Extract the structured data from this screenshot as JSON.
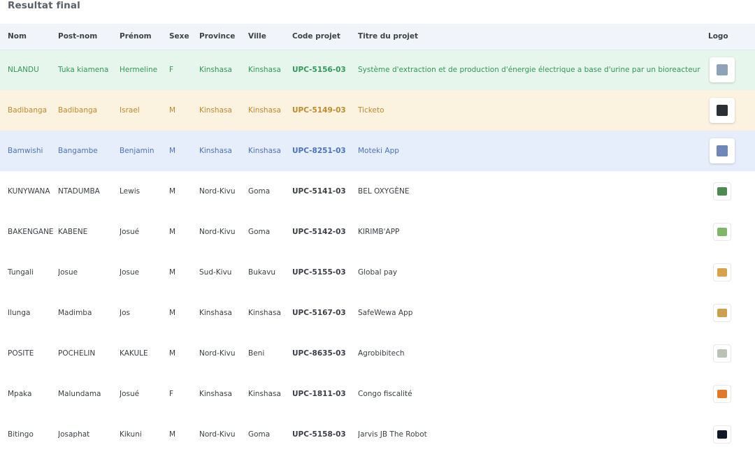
{
  "section_title": "Resultat final",
  "headers": {
    "nom": "Nom",
    "postnom": "Post-nom",
    "prenom": "Prénom",
    "sexe": "Sexe",
    "province": "Province",
    "ville": "Ville",
    "code": "Code projet",
    "titre": "Titre du projet",
    "logo": "Logo"
  },
  "rows": [
    {
      "nom": "NLANDU",
      "postnom": "Tuka kiamena",
      "prenom": "Hermeline",
      "sexe": "F",
      "province": "Kinshasa",
      "ville": "Kinshasa",
      "code": "UPC-5156-03",
      "titre": "Système d'extraction et de production d'énergie électrique a base d'urine par un bioreacteur"
    },
    {
      "nom": "Badibanga",
      "postnom": "Badibanga",
      "prenom": "Israel",
      "sexe": "M",
      "province": "Kinshasa",
      "ville": "Kinshasa",
      "code": "UPC-5149-03",
      "titre": "Ticketo"
    },
    {
      "nom": "Bamwishi",
      "postnom": "Bangambe",
      "prenom": "Benjamin",
      "sexe": "M",
      "province": "Kinshasa",
      "ville": "Kinshasa",
      "code": "UPC-8251-03",
      "titre": "Moteki App"
    },
    {
      "nom": "KUNYWANA",
      "postnom": "NTADUMBA",
      "prenom": "Lewis",
      "sexe": "M",
      "province": "Nord-Kivu",
      "ville": "Goma",
      "code": "UPC-5141-03",
      "titre": "BEL OXYGÈNE"
    },
    {
      "nom": "BAKENGANE",
      "postnom": "KABENE",
      "prenom": "Josué",
      "sexe": "M",
      "province": "Nord-Kivu",
      "ville": "Goma",
      "code": "UPC-5142-03",
      "titre": "KIRIMB'APP"
    },
    {
      "nom": "Tungali",
      "postnom": "Josue",
      "prenom": "Josue",
      "sexe": "M",
      "province": "Sud-Kivu",
      "ville": "Bukavu",
      "code": "UPC-5155-03",
      "titre": "Global pay"
    },
    {
      "nom": "Ilunga",
      "postnom": "Madimba",
      "prenom": "Jos",
      "sexe": "M",
      "province": "Kinshasa",
      "ville": "Kinshasa",
      "code": "UPC-5167-03",
      "titre": "SafeWewa App"
    },
    {
      "nom": "POSITE",
      "postnom": "POCHELIN",
      "prenom": "KAKULE",
      "sexe": "M",
      "province": "Nord-Kivu",
      "ville": "Beni",
      "code": "UPC-8635-03",
      "titre": "Agrobibitech"
    },
    {
      "nom": "Mpaka",
      "postnom": "Malundama",
      "prenom": "Josué",
      "sexe": "F",
      "province": "Kinshasa",
      "ville": "Kinshasa",
      "code": "UPC-1811-03",
      "titre": "Congo fiscalité"
    },
    {
      "nom": "Bitingo",
      "postnom": "Josaphat",
      "prenom": "Kikuni",
      "sexe": "M",
      "province": "Nord-Kivu",
      "ville": "Goma",
      "code": "UPC-5158-03",
      "titre": "Jarvis JB The Robot"
    }
  ],
  "colors": {
    "green_text": "#2f9a57",
    "green_bg": "#e6f6ec",
    "yellow_text": "#c08a2a",
    "yellow_bg": "#fbf2df",
    "blue_text": "#4a72c4",
    "blue_bg": "#e6edfb",
    "header_bg": "#f1f4f8"
  },
  "logo_colors": [
    "#8fa3b8",
    "#2b2f36",
    "#6f86b8",
    "#4c8a4f",
    "#7fb66a",
    "#d8a24c",
    "#c9a14a",
    "#b9c2b4",
    "#e07a2a",
    "#111827"
  ]
}
